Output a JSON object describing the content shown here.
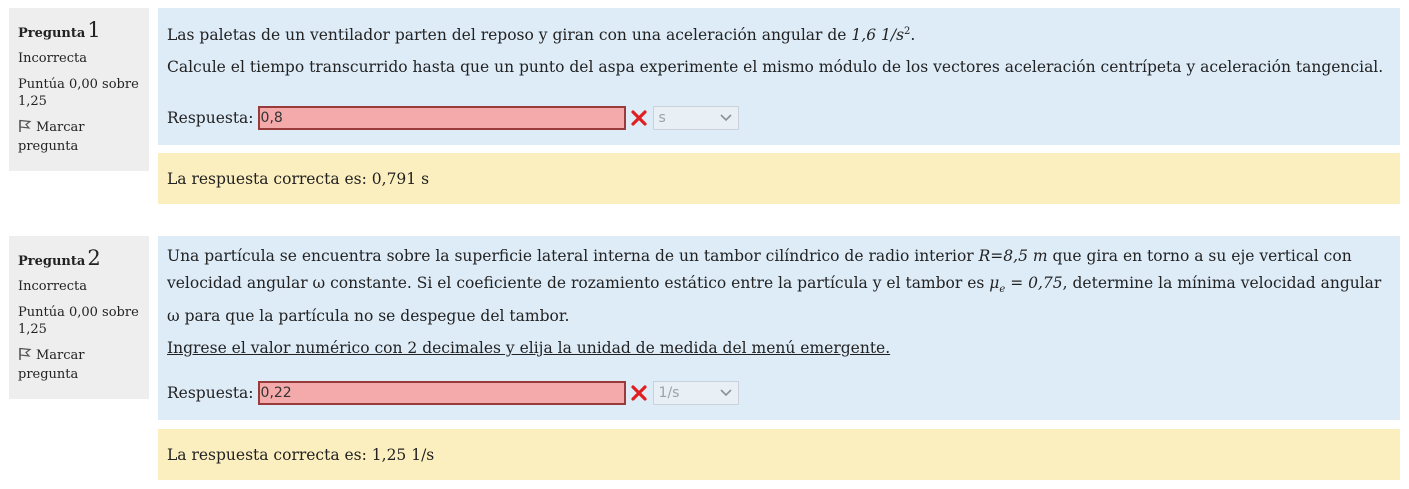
{
  "questions": [
    {
      "label": "Pregunta",
      "number": "1",
      "state": "Incorrecta",
      "grade": "Puntúa 0,00 sobre 1,25",
      "flag_label": "Marcar pregunta",
      "text_intro": "Las paletas de un ventilador parten del reposo y giran  con  una  aceleración  angular   de ",
      "text_value": "1,6 1/s",
      "text_sup": "2",
      "text_end": ".",
      "instruction": "Calcule el tiempo transcurrido hasta que un punto del aspa experimente el mismo módulo de los vectores aceleración centrípeta y  aceleración tangencial.",
      "answer_label": "Respuesta:",
      "answer_value": "0,8",
      "unit": "s",
      "feedback": "La respuesta correcta es: 0,791 s"
    },
    {
      "label": "Pregunta",
      "number": "2",
      "state": "Incorrecta",
      "grade": "Puntúa 0,00 sobre 1,25",
      "flag_label": "Marcar pregunta",
      "text_a": "Una partícula se encuentra sobre la superficie lateral interna de un tambor cilíndrico de radio interior ",
      "text_radius": "R=8,5 m",
      "text_b": " que gira en torno a su eje vertical con velocidad angular ω constante. Si el coeficiente de rozamiento estático entre la partícula  y el tambor es ",
      "text_mu": "μ",
      "text_mu_sub": "e",
      "text_mu_val": " = 0,75",
      "text_c": ", determine la mínima velocidad angular ω para que la partícula no se despegue del tambor.",
      "instruction": "Ingrese el valor numérico con 2 decimales y elija la unidad de medida del menú emergente.",
      "answer_label": "Respuesta:",
      "answer_value": "0,22",
      "unit": "1/s",
      "feedback": "La respuesta correcta es: 1,25 1/s"
    }
  ]
}
